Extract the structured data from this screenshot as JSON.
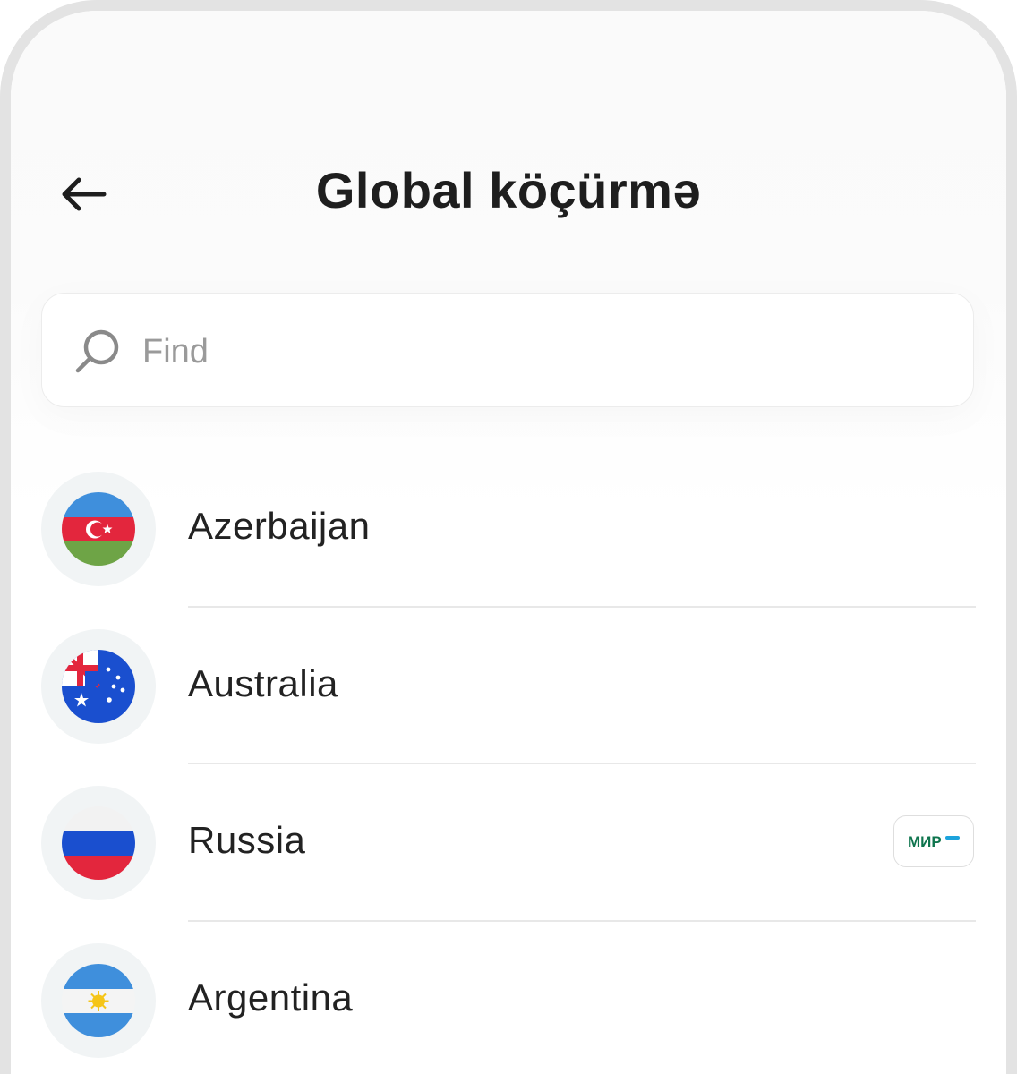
{
  "header": {
    "title": "Global köçürmə"
  },
  "search": {
    "placeholder": "Find",
    "value": ""
  },
  "countries": [
    {
      "name": "Azerbaijan",
      "flag": "azerbaijan-flag"
    },
    {
      "name": "Australia",
      "flag": "australia-flag"
    },
    {
      "name": "Russia",
      "flag": "russia-flag",
      "card_network_logo": "mir-logo"
    },
    {
      "name": "Argentina",
      "flag": "argentina-flag"
    }
  ],
  "colors": {
    "title": "#1e1e1e",
    "placeholder": "#9a9a9a",
    "flag_background": "#f1f4f5",
    "mir_green": "#0f754e",
    "mir_blue": "#1ca3dc"
  }
}
